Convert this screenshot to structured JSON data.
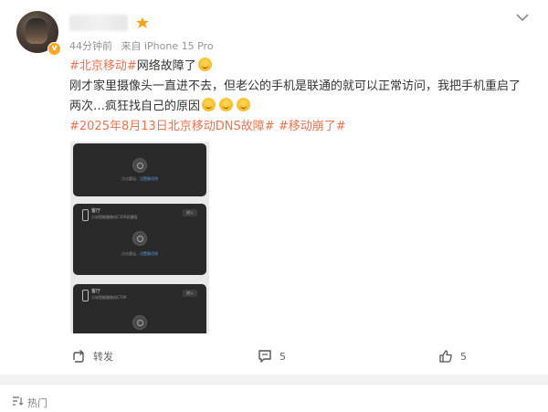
{
  "post": {
    "meta": {
      "time": "44分钟前",
      "source": "来自 iPhone 15 Pro"
    },
    "content": {
      "topic1": "#北京移动#",
      "line1_rest": "网络故障了",
      "line2": "刚才家里摄像头一直进不去，但老公的手机是联通的就可以正常访问，我把手机重启了",
      "line3": "两次…疯狂找自己的原因",
      "topic2": "#2025年8月13日北京移动DNS故障#",
      "topic3": "#移动崩了#"
    },
    "image": {
      "cards": [
        {
          "hint_prefix": "点击重连，",
          "hint_link": "设置备用线",
          "title": "",
          "subtitle": "",
          "button": ""
        },
        {
          "title": "客厅",
          "subtitle": "小米智能摄像机C300双摄版",
          "button": "进入",
          "hint_prefix": "点击重连，",
          "hint_link": "设置备用线"
        },
        {
          "title": "客厅",
          "subtitle": "小米智能摄像机C700",
          "button": "进入"
        }
      ]
    },
    "actions": {
      "repost_label": "转发",
      "comment_count": "5",
      "like_count": "5"
    },
    "colors": {
      "topic": "#eb7350",
      "meta": "#939393",
      "text": "#333333",
      "badge": "#ffa826"
    }
  },
  "footer": {
    "label": "热门"
  }
}
